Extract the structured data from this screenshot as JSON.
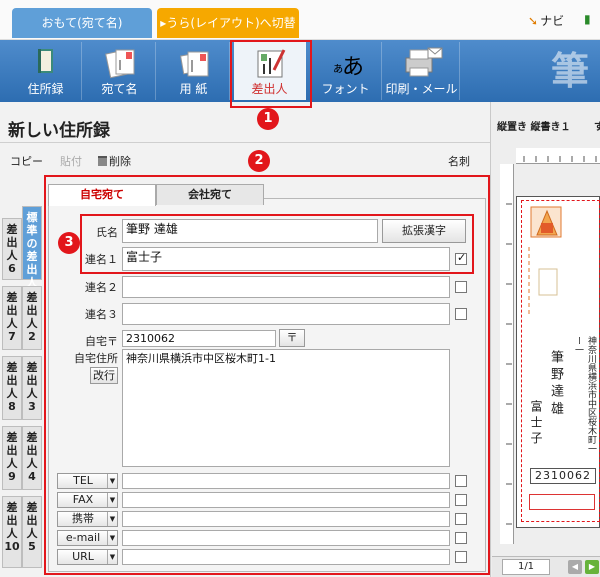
{
  "top_tabs": {
    "omote": "おもて(宛て名)",
    "ura": "▸うら(レイアウト)へ切替"
  },
  "top_right": {
    "navi": "ナビ",
    "help": ""
  },
  "ribbon": {
    "items": [
      "住所録",
      "宛て名",
      "用 紙",
      "差出人",
      "フォント",
      "印刷・メール"
    ],
    "big_char": "筆"
  },
  "badges": [
    "1",
    "2",
    "3"
  ],
  "panel": {
    "title": "新しい住所録"
  },
  "toolbar": {
    "copy": "コピー",
    "paste": "貼付",
    "delete": "削除",
    "meishi": "名刺"
  },
  "sender_tabs": [
    {
      "label": "標準の差出人"
    },
    {
      "label": "差出人6"
    },
    {
      "label": "差出人2"
    },
    {
      "label": "差出人7"
    },
    {
      "label": "差出人3"
    },
    {
      "label": "差出人8"
    },
    {
      "label": "差出人4"
    },
    {
      "label": "差出人9"
    },
    {
      "label": "差出人5"
    },
    {
      "label": "差出人10"
    }
  ],
  "form_tabs": {
    "home": "自宅宛て",
    "company": "会社宛て"
  },
  "fields": {
    "name_label": "氏名",
    "name_value": "筆野 達雄",
    "ext_kanji": "拡張漢字",
    "ren1_label": "連名１",
    "ren1_value": "富士子",
    "ren2_label": "連名２",
    "ren3_label": "連名３",
    "zip_label": "自宅〒",
    "zip_value": "2310062",
    "zip_btn": "〒",
    "addr_label": "自宅住所",
    "addr_value": "神奈川県横浜市中区桜木町1-1",
    "newline_btn": "改行"
  },
  "contact_labels": [
    "TEL",
    "FAX",
    "携帯",
    "e-mail",
    "URL"
  ],
  "preview": {
    "label": "縦置き 縦書き１",
    "label_cut": "す",
    "card_address": "神奈川県横浜市中区桜木町一ー一",
    "card_name": "筆 野  達 雄",
    "card_ren": "富 士 子",
    "card_zip": "2310062",
    "page": "1/1"
  }
}
